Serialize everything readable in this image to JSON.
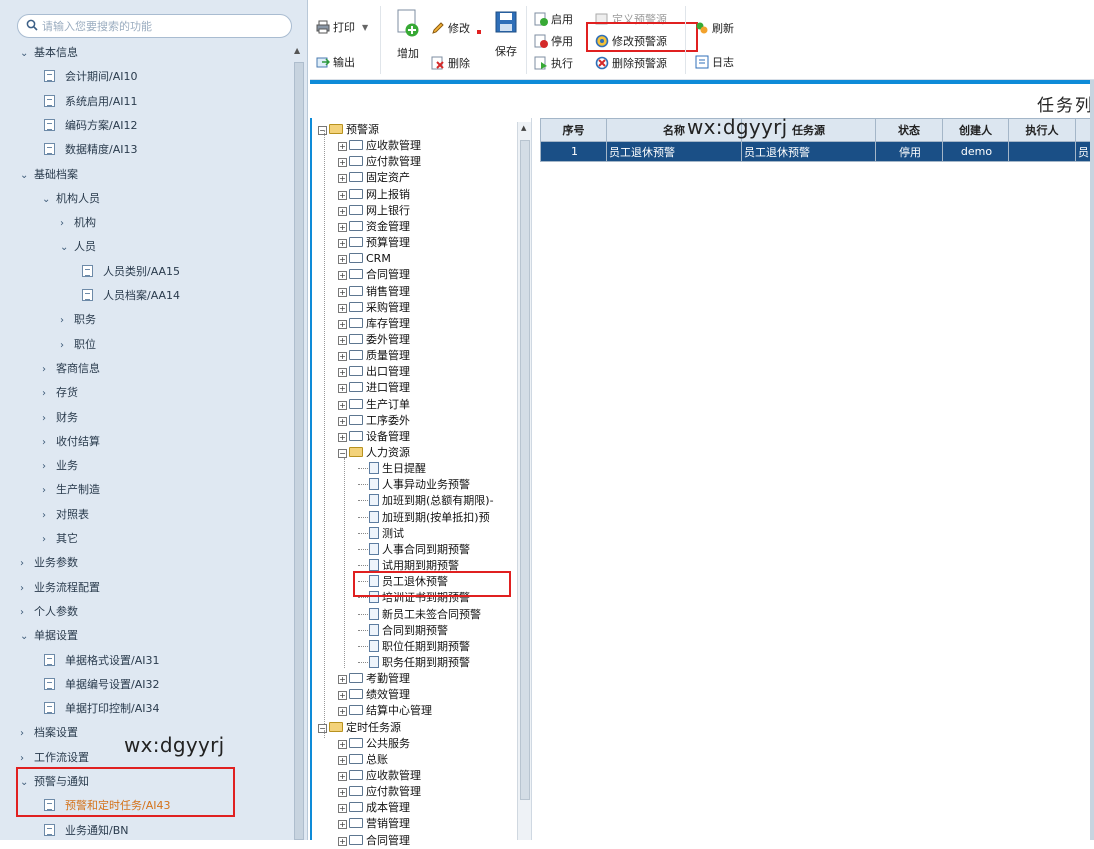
{
  "search": {
    "placeholder": "请输入您要搜索的功能"
  },
  "nav": [
    {
      "label": "基本信息",
      "arrow": "⌄"
    },
    {
      "label": "会计期间/AI10"
    },
    {
      "label": "系统启用/AI11"
    },
    {
      "label": "编码方案/AI12"
    },
    {
      "label": "数据精度/AI13"
    },
    {
      "label": "基础档案",
      "arrow": "⌄"
    },
    {
      "label": "机构人员",
      "arrow": "⌄"
    },
    {
      "label": "机构",
      "arrow": "›"
    },
    {
      "label": "人员",
      "arrow": "⌄"
    },
    {
      "label": "人员类别/AA15"
    },
    {
      "label": "人员档案/AA14"
    },
    {
      "label": "职务",
      "arrow": "›"
    },
    {
      "label": "职位",
      "arrow": "›"
    },
    {
      "label": "客商信息",
      "arrow": "›"
    },
    {
      "label": "存货",
      "arrow": "›"
    },
    {
      "label": "财务",
      "arrow": "›"
    },
    {
      "label": "收付结算",
      "arrow": "›"
    },
    {
      "label": "业务",
      "arrow": "›"
    },
    {
      "label": "生产制造",
      "arrow": "›"
    },
    {
      "label": "对照表",
      "arrow": "›"
    },
    {
      "label": "其它",
      "arrow": "›"
    },
    {
      "label": "业务参数",
      "arrow": "›"
    },
    {
      "label": "业务流程配置",
      "arrow": "›"
    },
    {
      "label": "个人参数",
      "arrow": "›"
    },
    {
      "label": "单据设置",
      "arrow": "⌄"
    },
    {
      "label": "单据格式设置/AI31"
    },
    {
      "label": "单据编号设置/AI32"
    },
    {
      "label": "单据打印控制/AI34"
    },
    {
      "label": "档案设置",
      "arrow": "›"
    },
    {
      "label": "工作流设置",
      "arrow": "›"
    },
    {
      "label": "预警与通知",
      "arrow": "⌄"
    },
    {
      "label": "预警和定时任务/AI43"
    },
    {
      "label": "业务通知/BN"
    }
  ],
  "watermark": "wx:dgyyrj",
  "toolbar": {
    "print": "打印",
    "output": "输出",
    "add": "增加",
    "edit": "修改",
    "delete": "删除",
    "save": "保存",
    "enable": "启用",
    "disable": "停用",
    "execute": "执行",
    "define": "定义预警源",
    "modify_source": "修改预警源",
    "delete_source": "删除预警源",
    "refresh": "刷新",
    "log": "日志"
  },
  "page_title": "任务列",
  "tree": [
    {
      "label": "预警源"
    },
    {
      "label": "应收款管理"
    },
    {
      "label": "应付款管理"
    },
    {
      "label": "固定资产"
    },
    {
      "label": "网上报销"
    },
    {
      "label": "网上银行"
    },
    {
      "label": "资金管理"
    },
    {
      "label": "预算管理"
    },
    {
      "label": "CRM"
    },
    {
      "label": "合同管理"
    },
    {
      "label": "销售管理"
    },
    {
      "label": "采购管理"
    },
    {
      "label": "库存管理"
    },
    {
      "label": "委外管理"
    },
    {
      "label": "质量管理"
    },
    {
      "label": "出口管理"
    },
    {
      "label": "进口管理"
    },
    {
      "label": "生产订单"
    },
    {
      "label": "工序委外"
    },
    {
      "label": "设备管理"
    },
    {
      "label": "人力资源"
    },
    {
      "label": "生日提醒"
    },
    {
      "label": "人事异动业务预警"
    },
    {
      "label": "加班到期(总额有期限)-"
    },
    {
      "label": "加班到期(按单抵扣)预"
    },
    {
      "label": "测试"
    },
    {
      "label": "人事合同到期预警"
    },
    {
      "label": "试用期到期预警"
    },
    {
      "label": "员工退休预警"
    },
    {
      "label": "培训证书到期预警"
    },
    {
      "label": "新员工未签合同预警"
    },
    {
      "label": "合同到期预警"
    },
    {
      "label": "职位任期到期预警"
    },
    {
      "label": "职务任期到期预警"
    },
    {
      "label": "考勤管理"
    },
    {
      "label": "绩效管理"
    },
    {
      "label": "结算中心管理"
    },
    {
      "label": "定时任务源"
    },
    {
      "label": "公共服务"
    },
    {
      "label": "总账"
    },
    {
      "label": "应收款管理"
    },
    {
      "label": "应付款管理"
    },
    {
      "label": "成本管理"
    },
    {
      "label": "营销管理"
    },
    {
      "label": "合同管理"
    }
  ],
  "grid": {
    "headers": [
      "序号",
      "名称",
      "任务源",
      "状态",
      "创建人",
      "执行人",
      ""
    ],
    "rows": [
      [
        "1",
        "员工退休预警",
        "员工退休预警",
        "停用",
        "demo",
        "",
        "员"
      ]
    ]
  }
}
